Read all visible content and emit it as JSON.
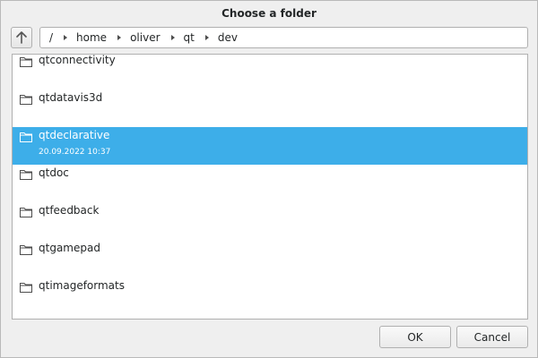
{
  "dialog": {
    "title": "Choose a folder"
  },
  "toolbar": {
    "up_icon": "arrow-up-icon"
  },
  "path": {
    "crumbs": [
      "/",
      "home",
      "oliver",
      "qt",
      "dev"
    ]
  },
  "list": {
    "items": [
      {
        "name": "qtconnectivity",
        "icon": "folder-icon"
      },
      {
        "name": "qtdatavis3d",
        "icon": "folder-icon"
      },
      {
        "name": "qtdeclarative",
        "modified": "20.09.2022 10:37",
        "selected": true,
        "icon": "folder-icon"
      },
      {
        "name": "qtdoc",
        "icon": "folder-icon"
      },
      {
        "name": "qtfeedback",
        "icon": "folder-icon"
      },
      {
        "name": "qtgamepad",
        "icon": "folder-icon"
      },
      {
        "name": "qtimageformats",
        "icon": "folder-icon"
      }
    ]
  },
  "buttons": {
    "ok_label": "OK",
    "cancel_label": "Cancel"
  },
  "colors": {
    "selection": "#3daee9",
    "text": "#232627"
  }
}
